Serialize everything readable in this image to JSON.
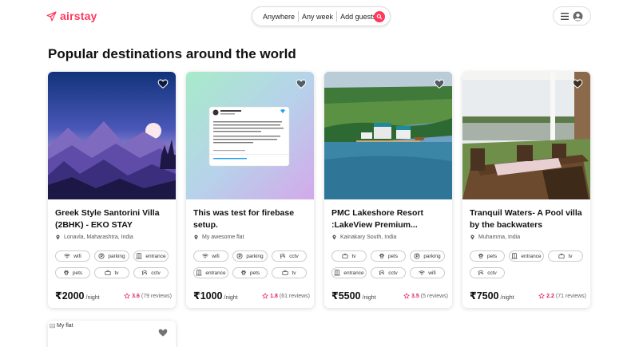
{
  "header": {
    "brand": "airstay",
    "search": {
      "anywhere": "Anywhere",
      "any_week": "Any week",
      "add_guests": "Add guests"
    }
  },
  "main": {
    "section_title": "Popular destinations around the world"
  },
  "colors": {
    "brand": "#ff385c",
    "rating": "#e31c5f"
  },
  "listings": [
    {
      "title": "Greek Style Santorini Villa (2BHK) - EKO STAY",
      "location": "Lonavla, Maharashtra, India",
      "amenities": [
        {
          "icon": "wifi-icon",
          "label": "wifi"
        },
        {
          "icon": "parking-icon",
          "label": "parking"
        },
        {
          "icon": "entrance-icon",
          "label": "entrance"
        },
        {
          "icon": "pets-icon",
          "label": "pets"
        },
        {
          "icon": "tv-icon",
          "label": "tv"
        },
        {
          "icon": "cctv-icon",
          "label": "cctv"
        }
      ],
      "price": "₹2000",
      "per": "/night",
      "rating": "3.6",
      "reviews": "(79 reviews)"
    },
    {
      "title": "This was test for firebase setup.",
      "location": "My awesome flat",
      "amenities": [
        {
          "icon": "wifi-icon",
          "label": "wifi"
        },
        {
          "icon": "parking-icon",
          "label": "parking"
        },
        {
          "icon": "cctv-icon",
          "label": "cctv"
        },
        {
          "icon": "entrance-icon",
          "label": "entrance"
        },
        {
          "icon": "pets-icon",
          "label": "pets"
        },
        {
          "icon": "tv-icon",
          "label": "tv"
        }
      ],
      "price": "₹1000",
      "per": "/night",
      "rating": "1.8",
      "reviews": "(61 reviews)"
    },
    {
      "title": "PMC Lakeshore Resort :LakeView Premium...",
      "location": "Kainakary South, India",
      "amenities": [
        {
          "icon": "tv-icon",
          "label": "tv"
        },
        {
          "icon": "pets-icon",
          "label": "pets"
        },
        {
          "icon": "parking-icon",
          "label": "parking"
        },
        {
          "icon": "entrance-icon",
          "label": "entrance"
        },
        {
          "icon": "cctv-icon",
          "label": "cctv"
        },
        {
          "icon": "wifi-icon",
          "label": "wifi"
        }
      ],
      "price": "₹5500",
      "per": "/night",
      "rating": "3.5",
      "reviews": "(5 reviews)"
    },
    {
      "title": "Tranquil Waters- A Pool villa by the backwaters",
      "location": "Muhamma, India",
      "amenities": [
        {
          "icon": "pets-icon",
          "label": "pets"
        },
        {
          "icon": "entrance-icon",
          "label": "entrance"
        },
        {
          "icon": "tv-icon",
          "label": "tv"
        },
        {
          "icon": "cctv-icon",
          "label": "cctv"
        }
      ],
      "price": "₹7500",
      "per": "/night",
      "rating": "2.2",
      "reviews": "(71 reviews)"
    }
  ],
  "partial_listing": {
    "image_alt": "My flat"
  }
}
